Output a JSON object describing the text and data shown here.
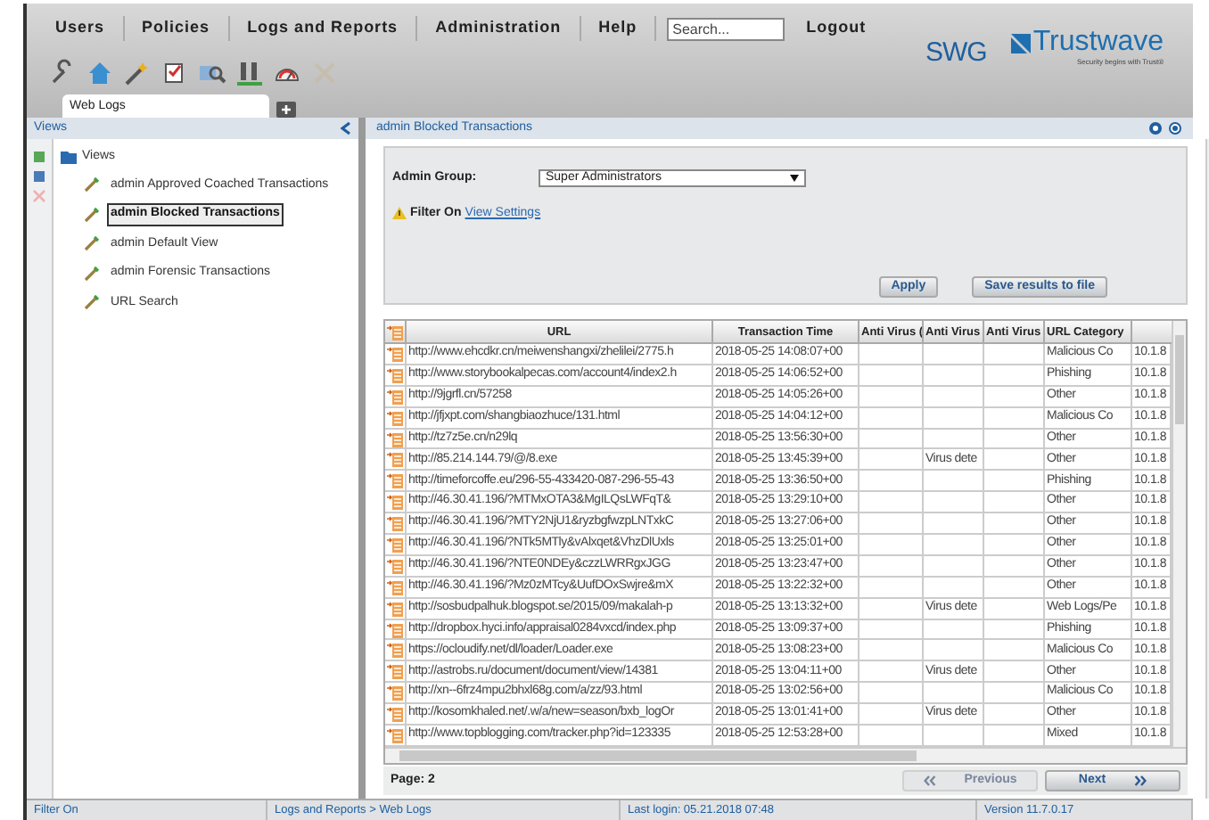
{
  "nav_menu": [
    "Users",
    "Policies",
    "Logs and Reports",
    "Administration",
    "Help"
  ],
  "search": {
    "placeholder": "Search..."
  },
  "logout": "Logout",
  "brand": {
    "product": "SWG",
    "logo": "Trustwave",
    "tagline": "Security begins with Trust®"
  },
  "toolbar": [
    {
      "disabled": false
    },
    {
      "disabled": false
    },
    {
      "disabled": false
    },
    {
      "disabled": false
    },
    {
      "disabled": false
    },
    {
      "disabled": false
    },
    {
      "disabled": false
    },
    {
      "disabled": true
    }
  ],
  "tabs": [
    {
      "label": "Web Logs",
      "selected": true
    }
  ],
  "left_panel": {
    "title": "Views",
    "actions": [
      {
        "disabled": false
      },
      {
        "disabled": false
      },
      {
        "disabled": true
      }
    ],
    "tree": {
      "label": "Views",
      "expanded": true,
      "children": [
        {
          "label": "admin Approved Coached Transactions",
          "selected": false
        },
        {
          "label": "admin Blocked Transactions",
          "selected": true
        },
        {
          "label": "admin Default View",
          "selected": false
        },
        {
          "label": "admin Forensic Transactions",
          "selected": false
        },
        {
          "label": "URL Search",
          "selected": false
        }
      ]
    }
  },
  "right_panel": {
    "title": "admin Blocked Transactions",
    "form": {
      "label": "Admin Group:",
      "select_value": "Super Administrators",
      "filter_text": "Filter On",
      "filter_link": "View Settings",
      "buttons": [
        "Apply",
        "Save results to file"
      ]
    },
    "table": {
      "columns": [
        "URL",
        "Transaction Time",
        "Anti Virus (",
        "Anti Virus",
        "Anti Virus",
        "URL Category"
      ],
      "rows": [
        {
          "url": "http://www.ehcdkr.cn/meiwenshangxi/zhelilei/2775.h",
          "time": "2018-05-25 14:08:07+00",
          "category": "Malicious Co",
          "column_8": "10.1.8"
        },
        {
          "url": "http://www.storybookalpecas.com/account4/index2.h",
          "time": "2018-05-25 14:06:52+00",
          "category": "Phishing",
          "column_8": "10.1.8"
        },
        {
          "url": "http://9jgrfl.cn/57258",
          "time": "2018-05-25 14:05:26+00",
          "category": "Other",
          "column_8": "10.1.8"
        },
        {
          "url": "http://jfjxpt.com/shangbiaozhuce/131.html",
          "time": "2018-05-25 14:04:12+00",
          "category": "Malicious Co",
          "column_8": "10.1.8"
        },
        {
          "url": "http://tz7z5e.cn/n29lq",
          "time": "2018-05-25 13:56:30+00",
          "category": "Other",
          "column_8": "10.1.8"
        },
        {
          "url": "http://85.214.144.79/@/8.exe",
          "time": "2018-05-25 13:45:39+00",
          "column_4": "Virus dete",
          "category": "Other",
          "column_8": "10.1.8"
        },
        {
          "url": "http://timeforcoffe.eu/296-55-433420-087-296-55-43",
          "time": "2018-05-25 13:36:50+00",
          "category": "Phishing",
          "column_8": "10.1.8"
        },
        {
          "url": "http://46.30.41.196/?MTMxOTA3&MgILQsLWFqT&",
          "time": "2018-05-25 13:29:10+00",
          "category": "Other",
          "column_8": "10.1.8"
        },
        {
          "url": "http://46.30.41.196/?MTY2NjU1&ryzbgfwzpLNTxkC",
          "time": "2018-05-25 13:27:06+00",
          "category": "Other",
          "column_8": "10.1.8"
        },
        {
          "url": "http://46.30.41.196/?NTk5MTly&vAlxqet&VhzDlUxls",
          "time": "2018-05-25 13:25:01+00",
          "category": "Other",
          "column_8": "10.1.8"
        },
        {
          "url": "http://46.30.41.196/?NTE0NDEy&czzLWRRgxJGG",
          "time": "2018-05-25 13:23:47+00",
          "category": "Other",
          "column_8": "10.1.8"
        },
        {
          "url": "http://46.30.41.196/?Mz0zMTcy&UufDOxSwjre&mX",
          "time": "2018-05-25 13:22:32+00",
          "category": "Other",
          "column_8": "10.1.8"
        },
        {
          "url": "http://sosbudpalhuk.blogspot.se/2015/09/makalah-p",
          "time": "2018-05-25 13:13:32+00",
          "column_4": "Virus dete",
          "category": "Web Logs/Pe",
          "column_8": "10.1.8"
        },
        {
          "url": "http://dropbox.hyci.info/appraisal0284vxcd/index.php",
          "time": "2018-05-25 13:09:37+00",
          "category": "Phishing",
          "column_8": "10.1.8"
        },
        {
          "url": "https://ocloudify.net/dl/loader/Loader.exe",
          "time": "2018-05-25 13:08:23+00",
          "category": "Malicious Co",
          "column_8": "10.1.8"
        },
        {
          "url": "http://astrobs.ru/document/document/view/14381",
          "time": "2018-05-25 13:04:11+00",
          "column_4": "Virus dete",
          "category": "Other",
          "column_8": "10.1.8"
        },
        {
          "url": "http://xn--6frz4mpu2bhxl68g.com/a/zz/93.html",
          "time": "2018-05-25 13:02:56+00",
          "category": "Malicious Co",
          "column_8": "10.1.8"
        },
        {
          "url": "http://kosomkhaled.net/.w/a/new=season/bxb_logOr",
          "time": "2018-05-25 13:01:41+00",
          "column_4": "Virus dete",
          "category": "Other",
          "column_8": "10.1.8"
        },
        {
          "url": "http://www.topblogging.com/tracker.php?id=123335",
          "time": "2018-05-25 12:53:28+00",
          "category": "Mixed",
          "column_8": "10.1.8"
        }
      ]
    },
    "pagination": {
      "page": "Page: 2",
      "previous": {
        "label": "Previous",
        "disabled": true
      },
      "next": {
        "label": "Next",
        "disabled": false
      }
    }
  },
  "status_bar": [
    "Filter On",
    "Logs and Reports >  Web Logs",
    "Last login: 05.21.2018 07:48",
    "Version 11.7.0.17"
  ]
}
